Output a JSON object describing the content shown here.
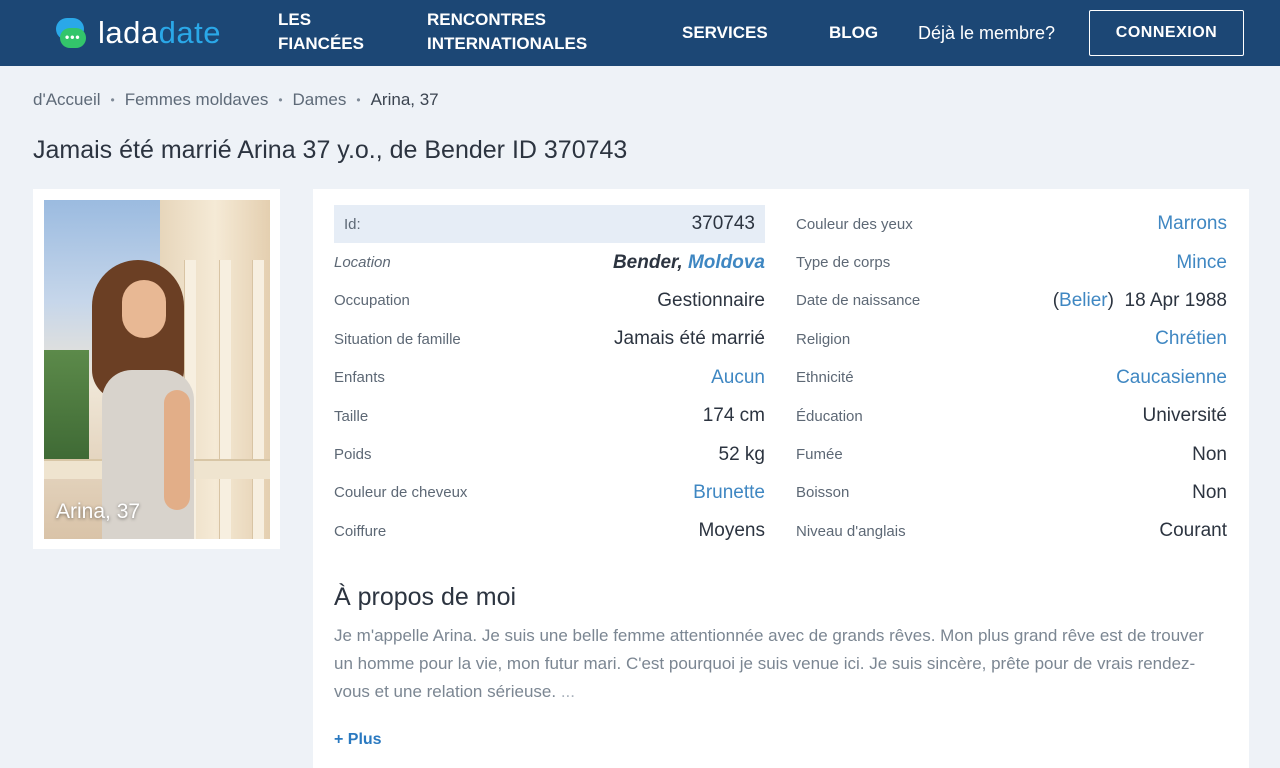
{
  "brand": {
    "logo_part1": "lada",
    "logo_part2": "date"
  },
  "nav": {
    "fiancees_line1": "LES",
    "fiancees_line2": "FIANCÉES",
    "intl_line1": "RENCONTRES",
    "intl_line2": "INTERNATIONALES",
    "services": "SERVICES",
    "blog": "BLOG",
    "member_prompt": "Déjà le membre?",
    "login": "CONNEXION"
  },
  "breadcrumb": [
    "d'Accueil",
    "Femmes moldaves",
    "Dames",
    "Arina, 37"
  ],
  "page_title": "Jamais été marrié Arina 37 y.o., de Bender ID 370743",
  "photo": {
    "caption": "Arina, 37"
  },
  "profile": {
    "left": {
      "id_label": "Id:",
      "id_value": "370743",
      "location_label": "Location",
      "location_city": "Bender,",
      "location_country": "Moldova",
      "occupation_label": "Occupation",
      "occupation_value": "Gestionnaire",
      "marital_label": "Situation de famille",
      "marital_value": "Jamais été marrié",
      "children_label": "Enfants",
      "children_value": "Aucun",
      "height_label": "Taille",
      "height_value": "174 cm",
      "weight_label": "Poids",
      "weight_value": "52 kg",
      "hair_color_label": "Couleur de cheveux",
      "hair_color_value": "Brunette",
      "hairstyle_label": "Coiffure",
      "hairstyle_value": "Moyens"
    },
    "right": {
      "eye_label": "Couleur des yeux",
      "eye_value": "Marrons",
      "body_label": "Type de corps",
      "body_value": "Mince",
      "birth_label": "Date de naissance",
      "zodiac": "Belier",
      "birth_date": "18 Apr 1988",
      "religion_label": "Religion",
      "religion_value": "Chrétien",
      "ethnicity_label": "Ethnicité",
      "ethnicity_value": "Caucasienne",
      "education_label": "Éducation",
      "education_value": "Université",
      "smoking_label": "Fumée",
      "smoking_value": "Non",
      "drinking_label": "Boisson",
      "drinking_value": "Non",
      "english_label": "Niveau d'anglais",
      "english_value": "Courant"
    }
  },
  "about": {
    "title": "À propos de moi",
    "text": "Je m'appelle Arina. Je suis une belle femme attentionnée avec de grands rêves. Mon plus grand rêve est de trouver un homme pour la vie, mon futur mari. C'est pourquoi je suis venue ici. Je suis sincère, prête pour de vrais rendez-vous et une relation sérieuse.",
    "ellipsis": "...",
    "more": "+ Plus"
  }
}
